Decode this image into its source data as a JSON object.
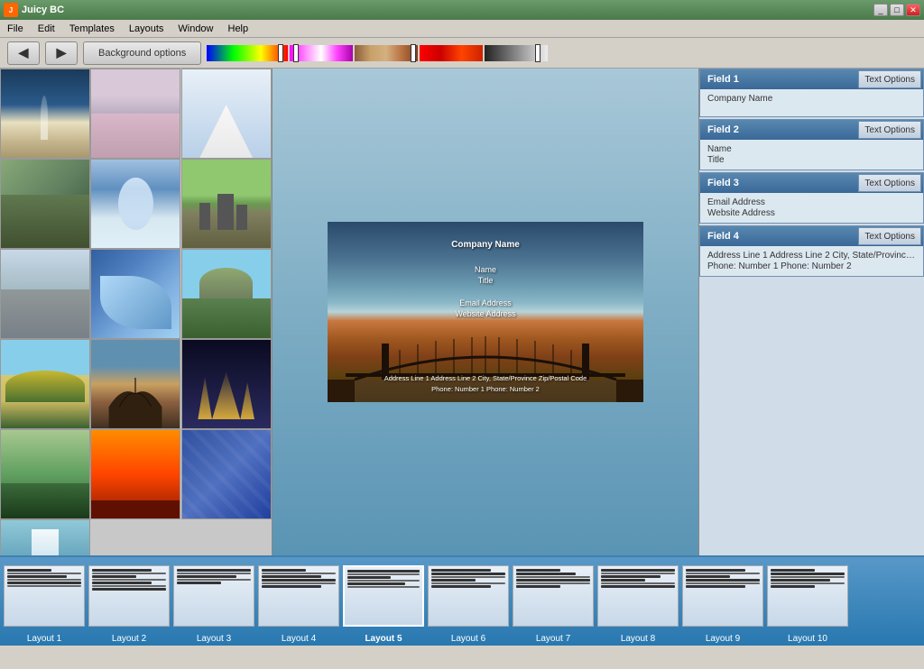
{
  "app": {
    "title": "Juicy BC",
    "icon": "J"
  },
  "menu": {
    "items": [
      "File",
      "Edit",
      "Templates",
      "Layouts",
      "Window",
      "Help"
    ]
  },
  "toolbar": {
    "back_label": "◀",
    "forward_label": "▶",
    "bg_options_label": "Background options"
  },
  "color_bars": {
    "slider1_pos": "88%",
    "slider2_pos": "10%",
    "slider3_pos": "88%"
  },
  "card": {
    "company_name": "Company Name",
    "name": "Name",
    "title": "Title",
    "email": "Email Address",
    "website": "Website Address",
    "address": "Address Line 1  Address Line 2  City, State/Province Zip/Postal Code",
    "phone": "Phone: Number 1  Phone: Number 2"
  },
  "fields": [
    {
      "id": "field1",
      "label": "Field 1",
      "text_options_label": "Text Options",
      "content": [
        "Company Name"
      ]
    },
    {
      "id": "field2",
      "label": "Field 2",
      "text_options_label": "Text Options",
      "content": [
        "Name",
        "Title"
      ]
    },
    {
      "id": "field3",
      "label": "Field 3",
      "text_options_label": "Text Options",
      "content": [
        "Email Address",
        "Website Address"
      ]
    },
    {
      "id": "field4",
      "label": "Field 4",
      "text_options_label": "Text Options",
      "content": [
        "Address Line 1  Address Line 2  City, State/Province Zi...",
        "Phone: Number 1  Phone: Number 2"
      ]
    }
  ],
  "thumbnails": [
    {
      "id": 1,
      "class": "thumb-blue",
      "alt": "fountain"
    },
    {
      "id": 2,
      "class": "thumb-mountain",
      "alt": "mountain pink"
    },
    {
      "id": 3,
      "class": "thumb-sky",
      "alt": "mountain snow"
    },
    {
      "id": 4,
      "class": "thumb-green",
      "alt": "green mountain"
    },
    {
      "id": 5,
      "class": "thumb-water",
      "alt": "waterfall mist"
    },
    {
      "id": 6,
      "class": "thumb-stonehenge",
      "alt": "stonehenge"
    },
    {
      "id": 7,
      "class": "thumb-rock",
      "alt": "rock mountain"
    },
    {
      "id": 8,
      "class": "thumb-wave",
      "alt": "wave ice"
    },
    {
      "id": 9,
      "class": "thumb-hill",
      "alt": "hill sky"
    },
    {
      "id": 10,
      "class": "thumb-tree",
      "alt": "yellow trees"
    },
    {
      "id": 11,
      "class": "thumb-bridge",
      "alt": "bridge sunset"
    },
    {
      "id": 12,
      "class": "thumb-city",
      "alt": "city night"
    },
    {
      "id": 13,
      "class": "thumb-forest",
      "alt": "forest green"
    },
    {
      "id": 14,
      "class": "thumb-sunset",
      "alt": "sunset red"
    },
    {
      "id": 15,
      "class": "thumb-pattern",
      "alt": "blue pattern"
    },
    {
      "id": 16,
      "class": "thumb-waterfall",
      "alt": "waterfall"
    }
  ],
  "layouts": [
    {
      "id": 1,
      "label": "Layout 1",
      "active": false
    },
    {
      "id": 2,
      "label": "Layout 2",
      "active": false
    },
    {
      "id": 3,
      "label": "Layout 3",
      "active": false
    },
    {
      "id": 4,
      "label": "Layout 4",
      "active": false
    },
    {
      "id": 5,
      "label": "Layout 5",
      "active": true
    },
    {
      "id": 6,
      "label": "Layout 6",
      "active": false
    },
    {
      "id": 7,
      "label": "Layout 7",
      "active": false
    },
    {
      "id": 8,
      "label": "Layout 8",
      "active": false
    },
    {
      "id": 9,
      "label": "Layout 9",
      "active": false
    },
    {
      "id": 10,
      "label": "Layout 10",
      "active": false
    }
  ]
}
